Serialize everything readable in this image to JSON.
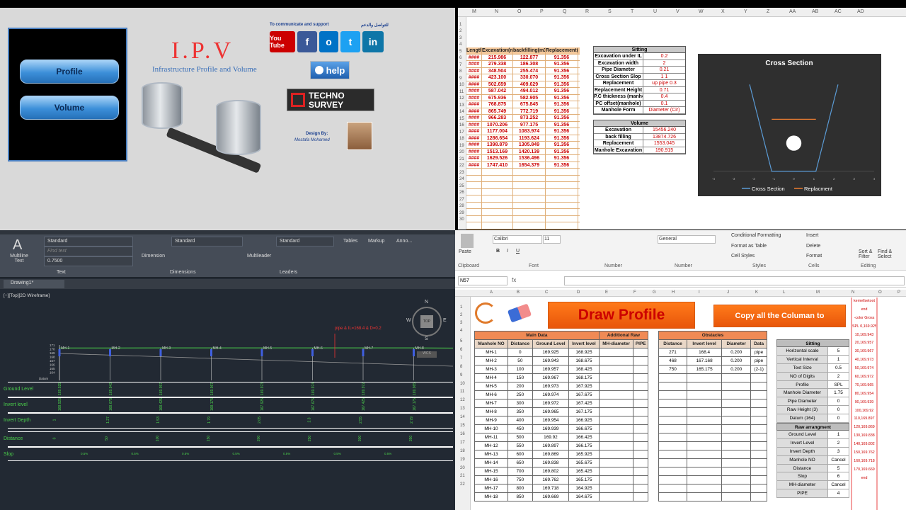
{
  "ipv": {
    "buttons": {
      "profile": "Profile",
      "volume": "Volume"
    },
    "title": "I.P.V",
    "subtitle": "Infrastructure Profile and Volume",
    "contact_en": "To communicate and support",
    "contact_ar": "للتواصل والدعم",
    "social": [
      "You Tube",
      "f",
      "o",
      "t",
      "in"
    ],
    "help": "help",
    "techno": "TECHNO",
    "survey": "SURVEY",
    "design_by": "Design By:",
    "designer": "Mostafa Mohamed"
  },
  "sheet1": {
    "cols": [
      "M",
      "N",
      "O",
      "P",
      "Q",
      "R",
      "S",
      "T",
      "U",
      "V",
      "W",
      "X",
      "Y",
      "Z",
      "AA",
      "AB",
      "AC",
      "AD"
    ],
    "header": [
      "Length",
      "Excavation(m3)",
      "backfilling(m3)",
      "Replacement(m3)"
    ],
    "rows": [
      [
        "####",
        "215.986",
        "122.877",
        "91.356"
      ],
      [
        "####",
        "279.338",
        "186.308",
        "91.356"
      ],
      [
        "####",
        "348.504",
        "255.474",
        "91.356"
      ],
      [
        "####",
        "423.100",
        "330.070",
        "91.356"
      ],
      [
        "####",
        "502.659",
        "409.629",
        "91.356"
      ],
      [
        "####",
        "587.042",
        "494.012",
        "91.356"
      ],
      [
        "####",
        "675.936",
        "582.905",
        "91.356"
      ],
      [
        "####",
        "768.875",
        "675.845",
        "91.356"
      ],
      [
        "####",
        "865.749",
        "772.719",
        "91.356"
      ],
      [
        "####",
        "966.283",
        "873.252",
        "91.356"
      ],
      [
        "####",
        "1070.206",
        "977.175",
        "91.356"
      ],
      [
        "####",
        "1177.004",
        "1083.974",
        "91.356"
      ],
      [
        "####",
        "1286.654",
        "1193.624",
        "91.356"
      ],
      [
        "####",
        "1398.879",
        "1305.849",
        "91.356"
      ],
      [
        "####",
        "1513.169",
        "1420.139",
        "91.356"
      ],
      [
        "####",
        "1629.526",
        "1536.496",
        "91.356"
      ],
      [
        "####",
        "1747.410",
        "1654.379",
        "91.356"
      ]
    ],
    "sitting": {
      "title": "Sitting",
      "rows": [
        [
          "Excavation under IL",
          "0.2"
        ],
        [
          "Excavation width",
          "2"
        ],
        [
          "Pipe Diameter",
          "0.21"
        ],
        [
          "Cross Section Slop",
          "1   1"
        ],
        [
          "Replacement",
          "up pipe   0.3"
        ],
        [
          "Replacement Height",
          "0.71"
        ],
        [
          "P.C thickness (manhole)",
          "0.4"
        ],
        [
          "PC offset(manhole)",
          "0.1"
        ],
        [
          "Manhole Form",
          "Diameter (Cir)"
        ]
      ]
    },
    "volume": {
      "title": "Volume",
      "rows": [
        [
          "Excavation",
          "15456.240"
        ],
        [
          "back filling",
          "13874.726"
        ],
        [
          "Replacement",
          "1553.045"
        ],
        [
          "Manhole Excavation",
          "190.915"
        ]
      ]
    }
  },
  "chart_data": {
    "type": "line",
    "title": "Cross Section",
    "series": [
      {
        "name": "Cross Section",
        "color": "#5b9bd5",
        "x": [
          -2.2,
          -1.1,
          1.1,
          2.2
        ],
        "y": [
          4,
          0,
          0,
          4
        ]
      },
      {
        "name": "Replacment",
        "color": "#ed7d31",
        "x": [
          -1.1,
          1.1
        ],
        "y": [
          2.4,
          2.4
        ]
      }
    ],
    "pipe": {
      "cx": 0,
      "cy": 1.3,
      "r": 0.21
    },
    "xlim": [
      -4,
      4
    ],
    "ylim": [
      -0.2,
      4.5
    ],
    "xticks": [
      "-4",
      "-3",
      "-2",
      "-1",
      "0",
      "1",
      "2",
      "3",
      "4"
    ],
    "legend": "bottom"
  },
  "cad": {
    "text_label": "Multiline Text",
    "find_placeholder": "Find text",
    "style1": "Standard",
    "height": "0.7500",
    "text_group": "Text",
    "dim_style": "Standard",
    "dimension": "Dimension",
    "dimensions_group": "Dimensions",
    "mleader_style": "Standard",
    "multileader": "Multileader",
    "leaders_group": "Leaders",
    "tables": "Tables",
    "markup": "Markup",
    "anno": "Anno...",
    "drawing_tab": "Drawing1*",
    "viewport_label": "[−][Top][2D Wireframe]",
    "annotation": "pipe & IL=168.4 & D=0.2",
    "compass": {
      "n": "N",
      "s": "S",
      "e": "E",
      "w": "W",
      "top": "TOP",
      "wcs": "WCS"
    },
    "bands": [
      "Ground Level",
      "Invert level",
      "Invert Depth",
      "Distance",
      "Slop"
    ],
    "manholes": [
      "MH-1",
      "MH-2",
      "MH-3",
      "MH-4",
      "MH-5",
      "MH-6",
      "MH-7",
      "MH-8"
    ],
    "y_ticks": [
      "171",
      "170",
      "169",
      "168",
      "167",
      "166",
      "165",
      "164"
    ],
    "datum": "Datum",
    "ground": [
      "169.925",
      "169.943",
      "169.957",
      "169.967",
      "169.973",
      "169.974",
      "169.972",
      "169.965"
    ],
    "invert": [
      "168.925",
      "168.675",
      "168.425",
      "168.175",
      "167.925",
      "167.675",
      "167.425",
      "167.175"
    ],
    "depth": [
      "1",
      "1.27",
      "1.53",
      "1.79",
      "2.05",
      "2.3",
      "2.55",
      "2.79"
    ],
    "distance": [
      "0",
      "50",
      "100",
      "150",
      "200",
      "250",
      "300",
      "350"
    ],
    "slope": [
      "0.5%",
      "0.5%",
      "0.5%",
      "0.5%",
      "0.5%",
      "0.5%",
      "0.5%"
    ]
  },
  "excel": {
    "font": "Calibri",
    "size": "11",
    "format": "General",
    "name_box": "N57",
    "ribbon_labels": [
      "Paste",
      "Clipboard",
      "Font",
      "Alignment",
      "Number",
      "Conditional Formatting",
      "Format as Table",
      "Cell Styles",
      "Styles",
      "Insert",
      "Delete",
      "Format",
      "Cells",
      "Sort & Filter",
      "Find & Select",
      "Editing"
    ],
    "cols": [
      "A",
      "B",
      "C",
      "D",
      "E",
      "F",
      "G",
      "H",
      "I",
      "J",
      "K",
      "L",
      "M",
      "N",
      "O",
      "P",
      "Q"
    ],
    "draw_profile": "Draw Profile",
    "copy_all": "Copy all the Columan to",
    "main_hdr": "Main Data",
    "add_hdr": "Additional Raw",
    "main_cols": [
      "Manhole NO",
      "Distance",
      "Ground Level",
      "Invert level",
      "MH-diameter",
      "PIPE"
    ],
    "main_rows": [
      [
        "MH-1",
        "0",
        "169.925",
        "168.925"
      ],
      [
        "MH-2",
        "50",
        "169.943",
        "168.675"
      ],
      [
        "MH-3",
        "100",
        "169.957",
        "168.425"
      ],
      [
        "MH-4",
        "150",
        "169.967",
        "168.175"
      ],
      [
        "MH-5",
        "200",
        "169.973",
        "167.925"
      ],
      [
        "MH-6",
        "250",
        "169.974",
        "167.675"
      ],
      [
        "MH-7",
        "300",
        "169.972",
        "167.425"
      ],
      [
        "MH-8",
        "350",
        "169.965",
        "167.175"
      ],
      [
        "MH-9",
        "400",
        "169.954",
        "166.925"
      ],
      [
        "MH-10",
        "450",
        "169.939",
        "166.675"
      ],
      [
        "MH-11",
        "500",
        "169.92",
        "166.425"
      ],
      [
        "MH-12",
        "550",
        "169.897",
        "166.175"
      ],
      [
        "MH-13",
        "600",
        "169.869",
        "165.925"
      ],
      [
        "MH-14",
        "650",
        "169.838",
        "165.675"
      ],
      [
        "MH-15",
        "700",
        "169.802",
        "165.425"
      ],
      [
        "MH-16",
        "750",
        "169.762",
        "165.175"
      ],
      [
        "MH-17",
        "800",
        "169.718",
        "164.925"
      ],
      [
        "MH-18",
        "850",
        "169.669",
        "164.675"
      ]
    ],
    "obst_hdr": "Obstacles",
    "obst_cols": [
      "Distance",
      "Invert level",
      "Diameter",
      "Data"
    ],
    "obst_rows": [
      [
        "271",
        "168.4",
        "0.200",
        "pipe"
      ],
      [
        "468",
        "167.168",
        "0.200",
        "pipe"
      ],
      [
        "750",
        "165.175",
        "0.200",
        "(2-1)"
      ]
    ],
    "sitting_title": "Sitting",
    "sitting_rows": [
      [
        "Horizontal scale",
        "5"
      ],
      [
        "Vertical Interval",
        "1"
      ],
      [
        "Text Size",
        "0.5"
      ],
      [
        "NO of Digits",
        "2"
      ],
      [
        "Profile",
        "SPL"
      ],
      [
        "Manhole Diameter",
        "1.75"
      ],
      [
        "Pipe Diameter",
        "0"
      ],
      [
        "Raw Height (3)",
        "0"
      ],
      [
        "Datum (164)",
        "0"
      ]
    ],
    "raw_title": "Raw arrangment",
    "raw_rows": [
      [
        "Ground Level",
        "1"
      ],
      [
        "Invert Level",
        "2"
      ],
      [
        "Invert Depth",
        "3"
      ],
      [
        "Manhole NO",
        "Cancel"
      ],
      [
        "Distance",
        "5"
      ],
      [
        "Slop",
        "6"
      ],
      [
        "MH-diameter",
        "Cancel"
      ],
      [
        "PIPE",
        "4"
      ]
    ],
    "redcol": [
      "kernellsetoot",
      "end",
      "-color Gross",
      "SPL 0,169.925",
      "10,169.943",
      "20,169.957",
      "30,169.967",
      "40,169.973",
      "50,169.974",
      "60,169.972",
      "70,169.965",
      "80,169.954",
      "90,169.939",
      "100,169.92",
      "110,169.897",
      "120,169.869",
      "130,169.838",
      "140,169.802",
      "150,169.762",
      "160,169.718",
      "170,169.669",
      "end"
    ]
  }
}
